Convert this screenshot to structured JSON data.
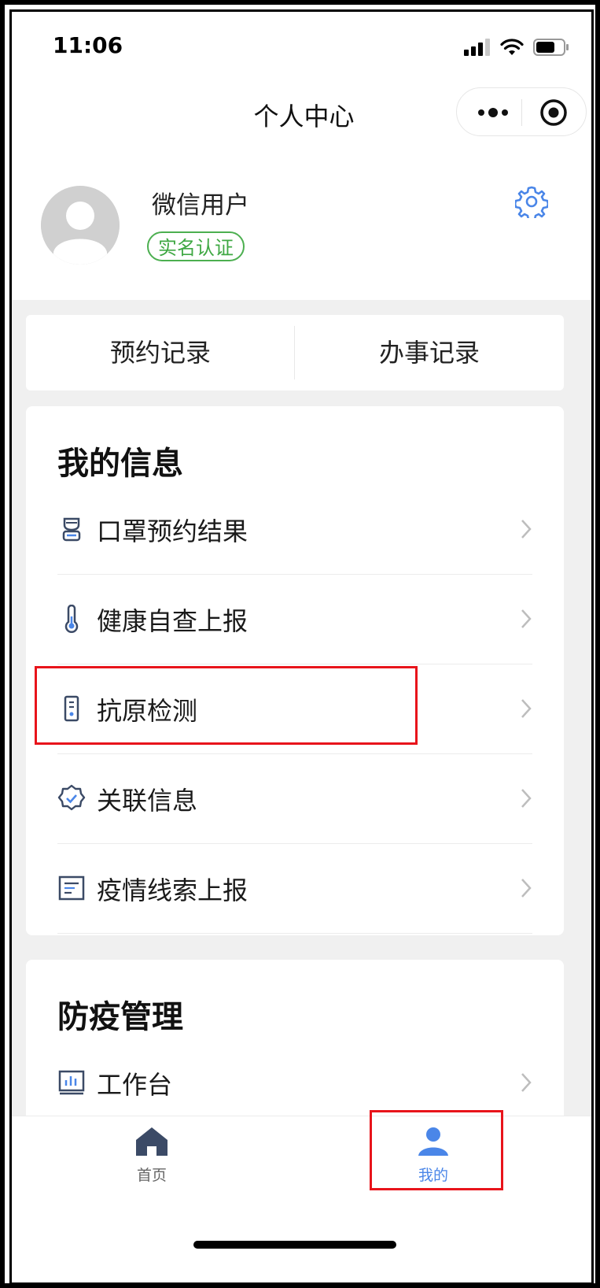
{
  "status": {
    "time": "11:06"
  },
  "nav": {
    "title": "个人中心"
  },
  "profile": {
    "name": "微信用户",
    "badge": "实名认证"
  },
  "records": {
    "left": "预约记录",
    "right": "办事记录"
  },
  "my_info": {
    "title": "我的信息",
    "items": [
      {
        "label": "口罩预约结果",
        "icon": "mask-icon"
      },
      {
        "label": "健康自查上报",
        "icon": "thermometer-icon"
      },
      {
        "label": "抗原检测",
        "icon": "test-kit-icon"
      },
      {
        "label": "关联信息",
        "icon": "verified-badge-icon"
      },
      {
        "label": "疫情线索上报",
        "icon": "document-list-icon"
      }
    ]
  },
  "epidemic": {
    "title": "防疫管理",
    "items": [
      {
        "label": "工作台",
        "icon": "dashboard-chart-icon"
      }
    ]
  },
  "tabbar": {
    "items": [
      {
        "label": "首页",
        "icon": "home-icon",
        "active": false
      },
      {
        "label": "我的",
        "icon": "person-icon",
        "active": true
      }
    ]
  },
  "colors": {
    "accent": "#4a86e8",
    "highlight": "#e8141b",
    "badge": "#4caf50"
  }
}
